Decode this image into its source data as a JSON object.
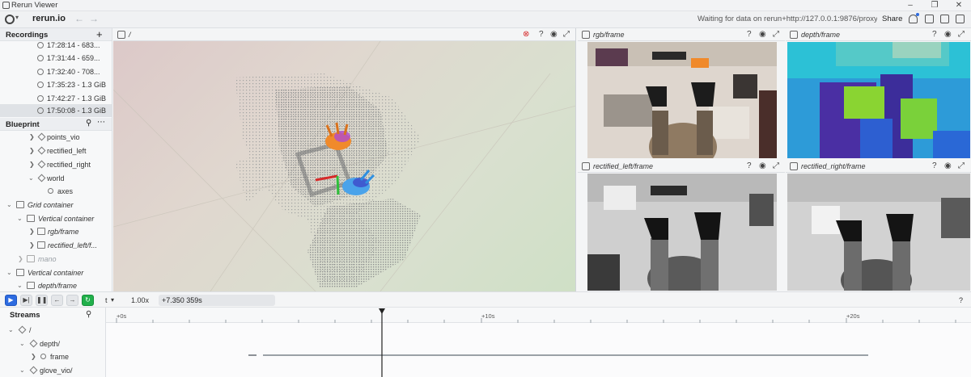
{
  "window": {
    "title": "Rerun Viewer"
  },
  "toolbar": {
    "brand": "rerun.io",
    "status": "Waiting for data on rerun+http://127.0.0.1:9876/proxy...",
    "share_label": "Share"
  },
  "recordings": {
    "header": "Recordings",
    "items": [
      {
        "label": "17:28:14 - 683..."
      },
      {
        "label": "17:31:44 - 659..."
      },
      {
        "label": "17:32:40 - 708..."
      },
      {
        "label": "17:35:23 - 1.3 GiB"
      },
      {
        "label": "17:42:27 - 1.3 GiB"
      },
      {
        "label": "17:50:08 - 1.3 GiB"
      }
    ]
  },
  "blueprint": {
    "header": "Blueprint",
    "items": [
      {
        "label": "points_vio"
      },
      {
        "label": "rectified_left"
      },
      {
        "label": "rectified_right"
      },
      {
        "label": "world"
      },
      {
        "label": "axes"
      },
      {
        "label": "Grid container"
      },
      {
        "label": "Vertical container"
      },
      {
        "label": "rgb/frame"
      },
      {
        "label": "rectified_left/f..."
      },
      {
        "label": "mano"
      },
      {
        "label": "Vertical container"
      },
      {
        "label": "depth/frame"
      }
    ]
  },
  "views": {
    "main3d": {
      "title": "/"
    },
    "rgb": {
      "title": "rgb/frame"
    },
    "depth": {
      "title": "depth/frame"
    },
    "rect_left": {
      "title": "rectified_left/frame"
    },
    "rect_right": {
      "title": "rectified_right/frame"
    },
    "help_glyph": "?"
  },
  "time_panel": {
    "timeline_name": "t",
    "speed": "1.00x",
    "current_time": "+7.350 359s",
    "help_glyph": "?",
    "ticks": [
      "+0s",
      "+10s",
      "+20s"
    ]
  },
  "streams": {
    "header": "Streams",
    "items": [
      {
        "label": "/"
      },
      {
        "label": "depth/"
      },
      {
        "label": "frame"
      },
      {
        "label": "glove_vio/"
      }
    ]
  },
  "colors": {
    "play_blue": "#2d6be0",
    "loop_green": "#21b04b",
    "axis_red": "#d62a2a",
    "axis_green": "#2fbf3a"
  }
}
